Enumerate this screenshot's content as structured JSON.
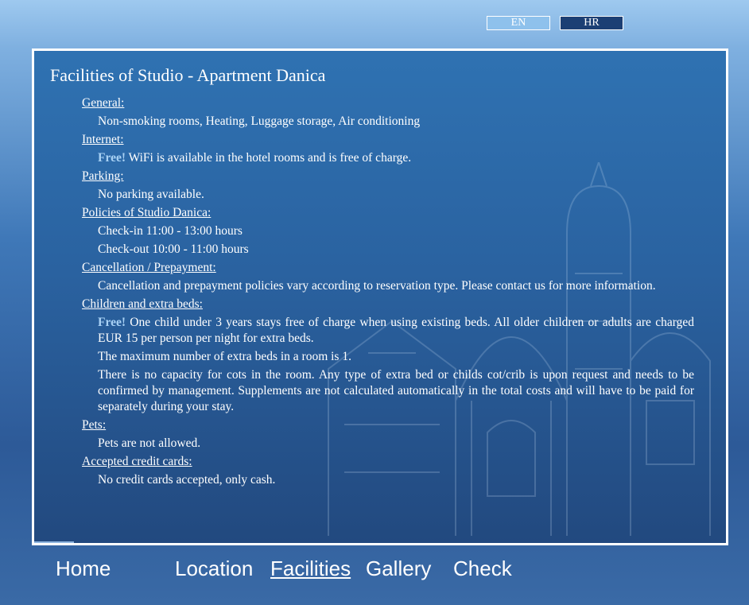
{
  "languages": {
    "en": "EN",
    "hr": "HR"
  },
  "page_title": "Facilities of Studio - Apartment Danica",
  "sections": {
    "general": {
      "label": "General:",
      "items": [
        "Non-smoking rooms, Heating, Luggage storage, Air conditioning"
      ]
    },
    "internet": {
      "label": "Internet:",
      "free": "Free!",
      "text": " WiFi is available in the hotel rooms and is free of charge."
    },
    "parking": {
      "label": "Parking:",
      "items": [
        "No parking available."
      ]
    },
    "policies": {
      "label": "Policies of Studio Danica:",
      "items": [
        "Check-in 11:00 - 13:00 hours",
        "Check-out 10:00 - 11:00 hours"
      ]
    },
    "cancellation": {
      "label": "Cancellation / Prepayment:",
      "items": [
        "Cancellation and prepayment policies vary according to reservation type. Please contact us for more information."
      ]
    },
    "children": {
      "label": "Children and extra beds:",
      "free": "Free!",
      "first_text": " One child under 3 years stays free of charge when using existing beds. All older children or adults are charged EUR 15 per person per night for extra beds.",
      "items": [
        "The maximum number of extra beds in a room is 1.",
        "There is no capacity for cots in the room. Any type of extra bed or childs cot/crib is upon request and needs to be confirmed by management. Supplements are not calculated automatically in the total costs and will have to be paid for separately during your stay."
      ]
    },
    "pets": {
      "label": "Pets:",
      "items": [
        "Pets are not allowed."
      ]
    },
    "credit_cards": {
      "label": "Accepted credit cards:",
      "items": [
        "No credit cards accepted, only cash."
      ]
    }
  },
  "nav": {
    "home": "Home",
    "location": "Location",
    "facilities": "Facilities",
    "gallery": "Gallery",
    "check": "Check"
  },
  "colors": {
    "panel": "#2f72b2",
    "accent_free": "#a9d2f5",
    "lang_en": "#8ec1ec",
    "lang_hr": "#1c3f74"
  }
}
